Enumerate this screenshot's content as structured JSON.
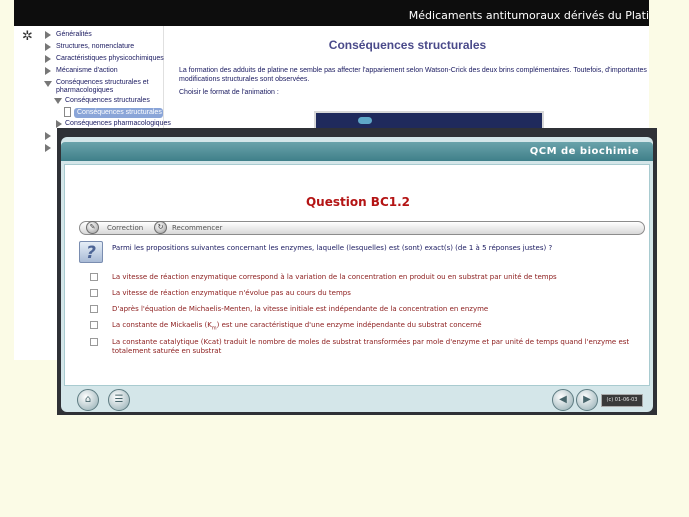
{
  "background_window": {
    "title": "Médicaments antitumoraux dérivés du Plati",
    "logo": "✲",
    "sidebar": {
      "items": [
        {
          "label": "Généralités"
        },
        {
          "label": "Structures, nomenclature"
        },
        {
          "label": "Caractéristiques physicochimiques"
        },
        {
          "label": "Mécanisme d'action"
        },
        {
          "label": "Conséquences structurales et pharmacologiques"
        },
        {
          "label": "Conséquences structurales"
        },
        {
          "label": "Conséquences structurales"
        },
        {
          "label": "Conséquences pharmacologiques"
        }
      ]
    },
    "heading": "Conséquences structurales",
    "paragraph": "La formation des adduits de platine ne semble pas affecter l'appariement selon Watson-Crick des deux brins complémentaires. Toutefois, d'importantes modifications structurales sont observées.",
    "choose_label": "Choisir le format de l'animation :"
  },
  "qcm": {
    "title": "QCM de biochimie",
    "question_title": "Question BC1.2",
    "toolbar": {
      "correction_label": "Correction",
      "restart_label": "Recommencer"
    },
    "help_icon_glyph": "?",
    "prompt": "Parmi les propositions suivantes concernant les enzymes, laquelle (lesquelles) est (sont) exact(s) (de 1 à 5 réponses justes) ?",
    "options": [
      {
        "text": "La vitesse de réaction enzymatique correspond à la variation de la concentration en produit ou en substrat par unité de temps",
        "checked": false
      },
      {
        "text": "La vitesse de réaction enzymatique n'évolue pas au cours du temps",
        "checked": false
      },
      {
        "text": "D'après l'équation de Michaelis-Menten, la vitesse initiale est indépendante de la concentration en enzyme",
        "checked": false
      },
      {
        "text_before": "La constante de Mickaelis (K",
        "subscript": "m",
        "text_after": ") est une caractéristique d'une enzyme indépendante du substrat concerné",
        "checked": false
      },
      {
        "text": "La constante catalytique (Kcat) traduit le nombre de moles de substrat transformées par mole d'enzyme et par unité de temps quand l'enzyme est totalement saturée en substrat",
        "checked": false
      }
    ],
    "footer": {
      "copyright": "(c) 01-06-03"
    }
  },
  "colors": {
    "page_background": "#fbfbe6",
    "question_title": "#b41414",
    "header_teal": "#4f8d96",
    "option_text": "#8b1b1b"
  }
}
